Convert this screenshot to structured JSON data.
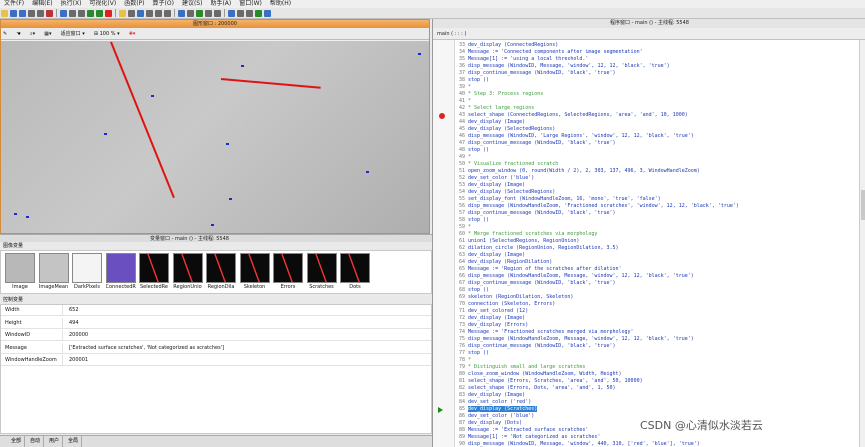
{
  "menu": [
    "文件(F)",
    "编辑(E)",
    "执行(X)",
    "可视化(V)",
    "函数(P)",
    "算子(O)",
    "建议(S)",
    "助手(A)",
    "窗口(W)",
    "帮助(H)"
  ],
  "graphics_window": {
    "title": "图形窗口 : 200000",
    "zoom": "100 %",
    "fit_label": "适应窗口"
  },
  "variable_status_bar": "变量窗口 - main () - 主线程: 5548",
  "icon_variables": {
    "header": "图像变量",
    "items": [
      {
        "label": "Image",
        "thumb": "#b8b8b8"
      },
      {
        "label": "ImageMean",
        "thumb": "#c4c4c4"
      },
      {
        "label": "DarkPixels",
        "thumb": "#f4f4f4"
      },
      {
        "label": "ConnectedR",
        "thumb": "#6a4fc0"
      },
      {
        "label": "SelectedRe",
        "thumb": "#0a0a0a"
      },
      {
        "label": "RegionUnio",
        "thumb": "#0a0a0a"
      },
      {
        "label": "RegionDila",
        "thumb": "#0a0a0a"
      },
      {
        "label": "Skeleton",
        "thumb": "#0a0a0a"
      },
      {
        "label": "Errors",
        "thumb": "#0a0a0a"
      },
      {
        "label": "Scratches",
        "thumb": "#0a0a0a"
      },
      {
        "label": "Dots",
        "thumb": "#0a0a0a"
      }
    ]
  },
  "control_variables": {
    "header": "控制变量",
    "rows": [
      {
        "name": "Width",
        "value": "652"
      },
      {
        "name": "Height",
        "value": "494"
      },
      {
        "name": "WindowID",
        "value": "200000"
      },
      {
        "name": "Message",
        "value": "['Extracted surface scratches', 'Not categorized as scratches']"
      },
      {
        "name": "WindowHandleZoom",
        "value": "200001"
      }
    ]
  },
  "bottom_tabs": [
    "全部",
    "自动",
    "用户",
    "全局"
  ],
  "program_window": {
    "title": "程序窗口 - main () - 主线程: 5548",
    "procedure": "main ( : : : )"
  },
  "code_lines": [
    {
      "n": "33",
      "t": "dev_display (ConnectedRegions)",
      "k": "op"
    },
    {
      "n": "34",
      "t": "Message := 'Connected components after image segmentation'",
      "k": "op"
    },
    {
      "n": "35",
      "t": "Message[1] := 'using a local threshold.'",
      "k": "op"
    },
    {
      "n": "36",
      "t": "disp_message (WindowID, Message, 'window', 12, 12, 'black', 'true')",
      "k": "op"
    },
    {
      "n": "37",
      "t": "disp_continue_message (WindowID, 'black', 'true')",
      "k": "op"
    },
    {
      "n": "38",
      "t": "stop ()",
      "k": "op"
    },
    {
      "n": "39",
      "t": "*",
      "k": "cm"
    },
    {
      "n": "40",
      "t": "* Step 3: Process regions",
      "k": "cm"
    },
    {
      "n": "41",
      "t": "*",
      "k": "cm"
    },
    {
      "n": "42",
      "t": "* Select large regions",
      "k": "cm"
    },
    {
      "n": "43",
      "t": "select_shape (ConnectedRegions, SelectedRegions, 'area', 'and', 10, 1000)",
      "k": "op"
    },
    {
      "n": "44",
      "t": "dev_display (Image)",
      "k": "op"
    },
    {
      "n": "45",
      "t": "dev_display (SelectedRegions)",
      "k": "op"
    },
    {
      "n": "46",
      "t": "disp_message (WindowID, 'Large Regions', 'window', 12, 12, 'black', 'true')",
      "k": "op"
    },
    {
      "n": "47",
      "t": "disp_continue_message (WindowID, 'black', 'true')",
      "k": "op"
    },
    {
      "n": "48",
      "t": "stop ()",
      "k": "op"
    },
    {
      "n": "49",
      "t": "*",
      "k": "cm"
    },
    {
      "n": "50",
      "t": "* Visualize fractioned scratch",
      "k": "cm"
    },
    {
      "n": "51",
      "t": "open_zoom_window (0, round(Width / 2), 2, 303, 137, 496, 3, WindowHandleZoom)",
      "k": "op"
    },
    {
      "n": "52",
      "t": "dev_set_color ('blue')",
      "k": "op"
    },
    {
      "n": "53",
      "t": "dev_display (Image)",
      "k": "op"
    },
    {
      "n": "54",
      "t": "dev_display (SelectedRegions)",
      "k": "op"
    },
    {
      "n": "55",
      "t": "set_display_font (WindowHandleZoom, 16, 'mono', 'true', 'false')",
      "k": "op"
    },
    {
      "n": "56",
      "t": "disp_message (WindowHandleZoom, 'Fractioned scratches', 'window', 12, 12, 'black', 'true')",
      "k": "op"
    },
    {
      "n": "57",
      "t": "disp_continue_message (WindowID, 'black', 'true')",
      "k": "op"
    },
    {
      "n": "58",
      "t": "stop ()",
      "k": "op"
    },
    {
      "n": "59",
      "t": "*",
      "k": "cm"
    },
    {
      "n": "60",
      "t": "* Merge fractioned scratches via morphology",
      "k": "cm"
    },
    {
      "n": "61",
      "t": "union1 (SelectedRegions, RegionUnion)",
      "k": "op"
    },
    {
      "n": "62",
      "t": "dilation_circle (RegionUnion, RegionDilation, 3.5)",
      "k": "op"
    },
    {
      "n": "63",
      "t": "dev_display (Image)",
      "k": "op"
    },
    {
      "n": "64",
      "t": "dev_display (RegionDilation)",
      "k": "op"
    },
    {
      "n": "65",
      "t": "Message := 'Region of the scratches after dilation'",
      "k": "op"
    },
    {
      "n": "66",
      "t": "disp_message (WindowHandleZoom, Message, 'window', 12, 12, 'black', 'true')",
      "k": "op"
    },
    {
      "n": "67",
      "t": "disp_continue_message (WindowID, 'black', 'true')",
      "k": "op"
    },
    {
      "n": "68",
      "t": "stop ()",
      "k": "op"
    },
    {
      "n": "69",
      "t": "skeleton (RegionDilation, Skeleton)",
      "k": "op"
    },
    {
      "n": "70",
      "t": "connection (Skeleton, Errors)",
      "k": "op"
    },
    {
      "n": "71",
      "t": "dev_set_colored (12)",
      "k": "op"
    },
    {
      "n": "72",
      "t": "dev_display (Image)",
      "k": "op"
    },
    {
      "n": "73",
      "t": "dev_display (Errors)",
      "k": "op"
    },
    {
      "n": "74",
      "t": "Message := 'Fractioned scratches merged via morphology'",
      "k": "op"
    },
    {
      "n": "75",
      "t": "disp_message (WindowHandleZoom, Message, 'window', 12, 12, 'black', 'true')",
      "k": "op"
    },
    {
      "n": "76",
      "t": "disp_continue_message (WindowID, 'black', 'true')",
      "k": "op"
    },
    {
      "n": "77",
      "t": "stop ()",
      "k": "op"
    },
    {
      "n": "78",
      "t": "*",
      "k": "cm"
    },
    {
      "n": "79",
      "t": "* Distinguish small and large scratches",
      "k": "cm"
    },
    {
      "n": "80",
      "t": "close_zoom_window (WindowHandleZoom, Width, Height)",
      "k": "op"
    },
    {
      "n": "81",
      "t": "select_shape (Errors, Scratches, 'area', 'and', 50, 10000)",
      "k": "op"
    },
    {
      "n": "82",
      "t": "select_shape (Errors, Dots, 'area', 'and', 1, 50)",
      "k": "op"
    },
    {
      "n": "83",
      "t": "dev_display (Image)",
      "k": "op"
    },
    {
      "n": "84",
      "t": "dev_set_color ('red')",
      "k": "op"
    },
    {
      "n": "85",
      "t": "dev_display (Scratches)",
      "k": "sel"
    },
    {
      "n": "86",
      "t": "dev_set_color ('blue')",
      "k": "op"
    },
    {
      "n": "87",
      "t": "dev_display (Dots)",
      "k": "op"
    },
    {
      "n": "88",
      "t": "Message := 'Extracted surface scratches'",
      "k": "op"
    },
    {
      "n": "89",
      "t": "Message[1] := 'Not categorized as scratches'",
      "k": "op"
    },
    {
      "n": "90",
      "t": "disp_message (WindowID, Message, 'window', 440, 310, ['red', 'blue'], 'true')",
      "k": "op"
    }
  ],
  "watermark": "CSDN @心清似水淡若云"
}
